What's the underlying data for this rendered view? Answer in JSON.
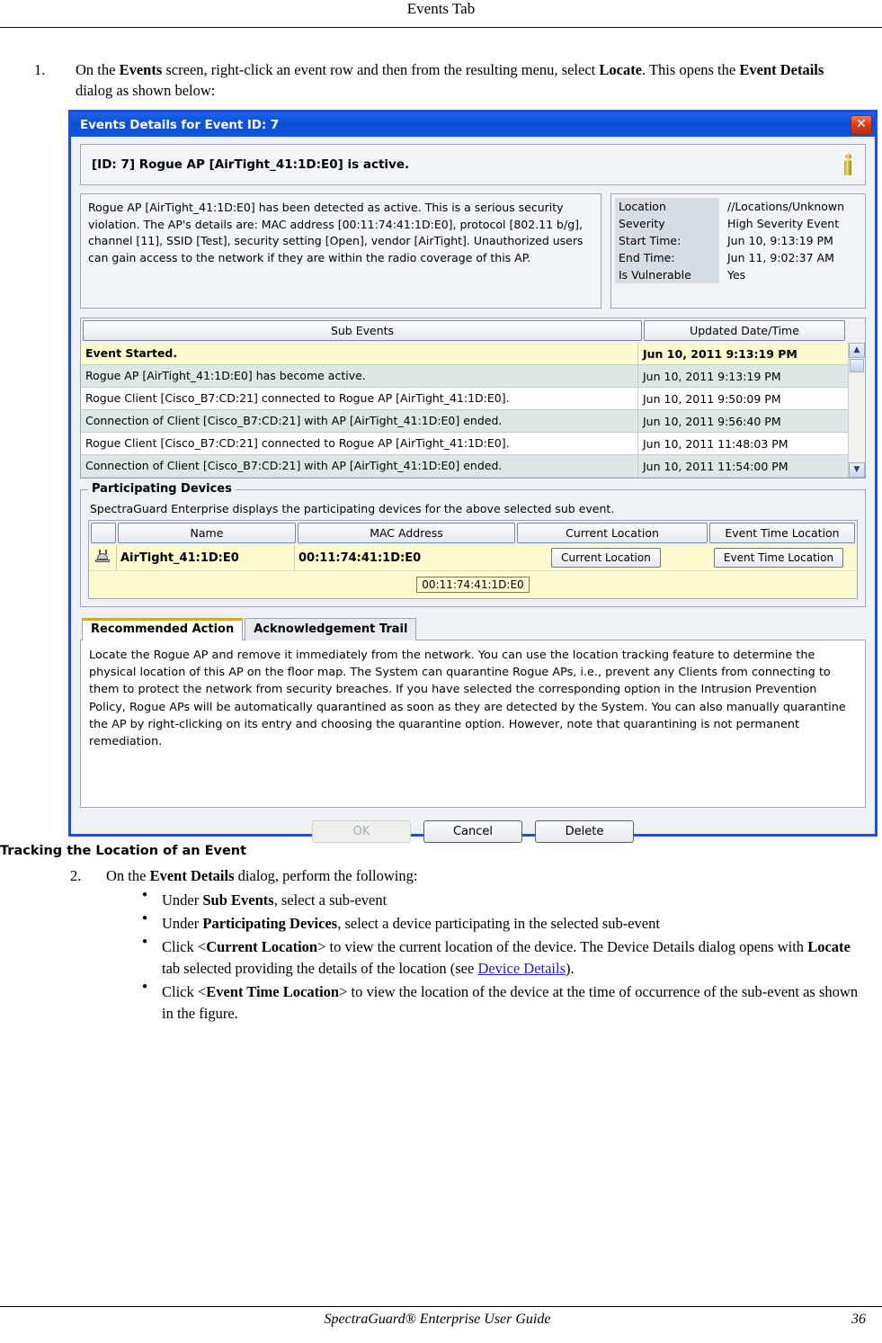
{
  "page": {
    "running_header": "Events Tab",
    "footer_title": "SpectraGuard®  Enterprise User Guide",
    "page_number": "36"
  },
  "step1": {
    "number": "1.",
    "part1": "On the ",
    "bold1": "Events",
    "part2": " screen, right-click an event row and then from the resulting menu, select ",
    "bold2": "Locate",
    "part3": ". This opens the ",
    "bold3": "Event Details",
    "part4": " dialog as shown below:"
  },
  "dialog": {
    "title": "Events Details for Event ID: 7",
    "close_label": "✕",
    "headline": "[ID: 7] Rogue AP [AirTight_41:1D:E0] is active.",
    "info_icon": "info-icon",
    "description": "Rogue AP [AirTight_41:1D:E0] has been detected as active. This is a serious security violation. The AP's details are: MAC address [00:11:74:41:1D:E0], protocol [802.11 b/g], channel [11], SSID [Test], security setting [Open], vendor [AirTight]. Unauthorized users can gain access to the network if they are within the radio coverage of this AP.",
    "properties": [
      {
        "key": "Location",
        "value": "//Locations/Unknown"
      },
      {
        "key": "Severity",
        "value": "High Severity Event"
      },
      {
        "key": "Start Time:",
        "value": "Jun 10, 9:13:19 PM"
      },
      {
        "key": "End Time:",
        "value": "Jun 11, 9:02:37 AM"
      },
      {
        "key": "Is Vulnerable",
        "value": "Yes"
      }
    ],
    "sub_events": {
      "columns": [
        "Sub Events",
        "Updated Date/Time"
      ],
      "rows": [
        {
          "text": "Event Started.",
          "time": "Jun 10, 2011 9:13:19 PM",
          "state": "selected"
        },
        {
          "text": "Rogue AP [AirTight_41:1D:E0] has become active.",
          "time": "Jun 10, 2011 9:13:19 PM",
          "state": "alt"
        },
        {
          "text": "Rogue Client [Cisco_B7:CD:21] connected to Rogue AP [AirTight_41:1D:E0].",
          "time": "Jun 10, 2011 9:50:09 PM",
          "state": "plain"
        },
        {
          "text": "Connection of Client [Cisco_B7:CD:21] with AP [AirTight_41:1D:E0] ended.",
          "time": "Jun 10, 2011 9:56:40 PM",
          "state": "alt"
        },
        {
          "text": "Rogue Client [Cisco_B7:CD:21] connected to Rogue AP [AirTight_41:1D:E0].",
          "time": "Jun 10, 2011 11:48:03 PM",
          "state": "plain"
        },
        {
          "text": "Connection of Client [Cisco_B7:CD:21] with AP [AirTight_41:1D:E0] ended.",
          "time": "Jun 10, 2011 11:54:00 PM",
          "state": "alt"
        }
      ],
      "scroll_up": "▲",
      "scroll_down": "▼"
    },
    "participating_devices": {
      "legend": "Participating Devices",
      "note": "SpectraGuard Enterprise displays the participating devices for the above selected sub event.",
      "columns": [
        "",
        "Name",
        "MAC Address",
        "Current Location",
        "Event Time Location"
      ],
      "row": {
        "device_icon": "access-point-icon",
        "name": "AirTight_41:1D:E0",
        "mac": "00:11:74:41:1D:E0",
        "current_location_button": "Current Location",
        "event_time_location_button": "Event Time Location"
      },
      "mac_chip": "00:11:74:41:1D:E0"
    },
    "tabs": [
      {
        "label": "Recommended Action",
        "active": true
      },
      {
        "label": "Acknowledgement Trail",
        "active": false
      }
    ],
    "recommended_action_text": "Locate the Rogue AP and remove it immediately from the network. You can use the location tracking feature to determine the physical location of this AP on the floor map. The System can quarantine Rogue APs, i.e., prevent any Clients from connecting to them to protect the network from security breaches. If you have selected the corresponding option in the Intrusion Prevention Policy, Rogue APs will be automatically quarantined as soon as they are detected by the System. You can also manually quarantine the AP by right-clicking on its entry and choosing the quarantine option. However, note that quarantining is not permanent remediation.",
    "buttons": [
      {
        "label": "OK",
        "disabled": true
      },
      {
        "label": "Cancel",
        "disabled": false
      },
      {
        "label": "Delete",
        "disabled": false
      }
    ]
  },
  "section_heading": "Tracking the Location of an Event",
  "step2": {
    "number": "2.",
    "lead_part1": "On the ",
    "lead_bold": "Event Details",
    "lead_part2": " dialog, perform the following:",
    "bullets": [
      {
        "p1": "Under ",
        "b1": "Sub Events",
        "p2": ", select a sub-event"
      },
      {
        "p1": "Under ",
        "b1": "Participating Devices",
        "p2": ", select a device participating in the selected sub-event"
      },
      {
        "p1": "Click <",
        "b1": "Current Location",
        "p2": "> to view the current location of the device. The Device Details dialog opens with ",
        "b2": "Locate",
        "p3": " tab selected providing the details of the location (see ",
        "link": "Device Details",
        "p4": ")."
      },
      {
        "p1": "Click <",
        "b1": "Event Time Location",
        "p2": "> to view the location of the device at the time of occurrence of the sub-event as shown in the figure."
      }
    ]
  }
}
